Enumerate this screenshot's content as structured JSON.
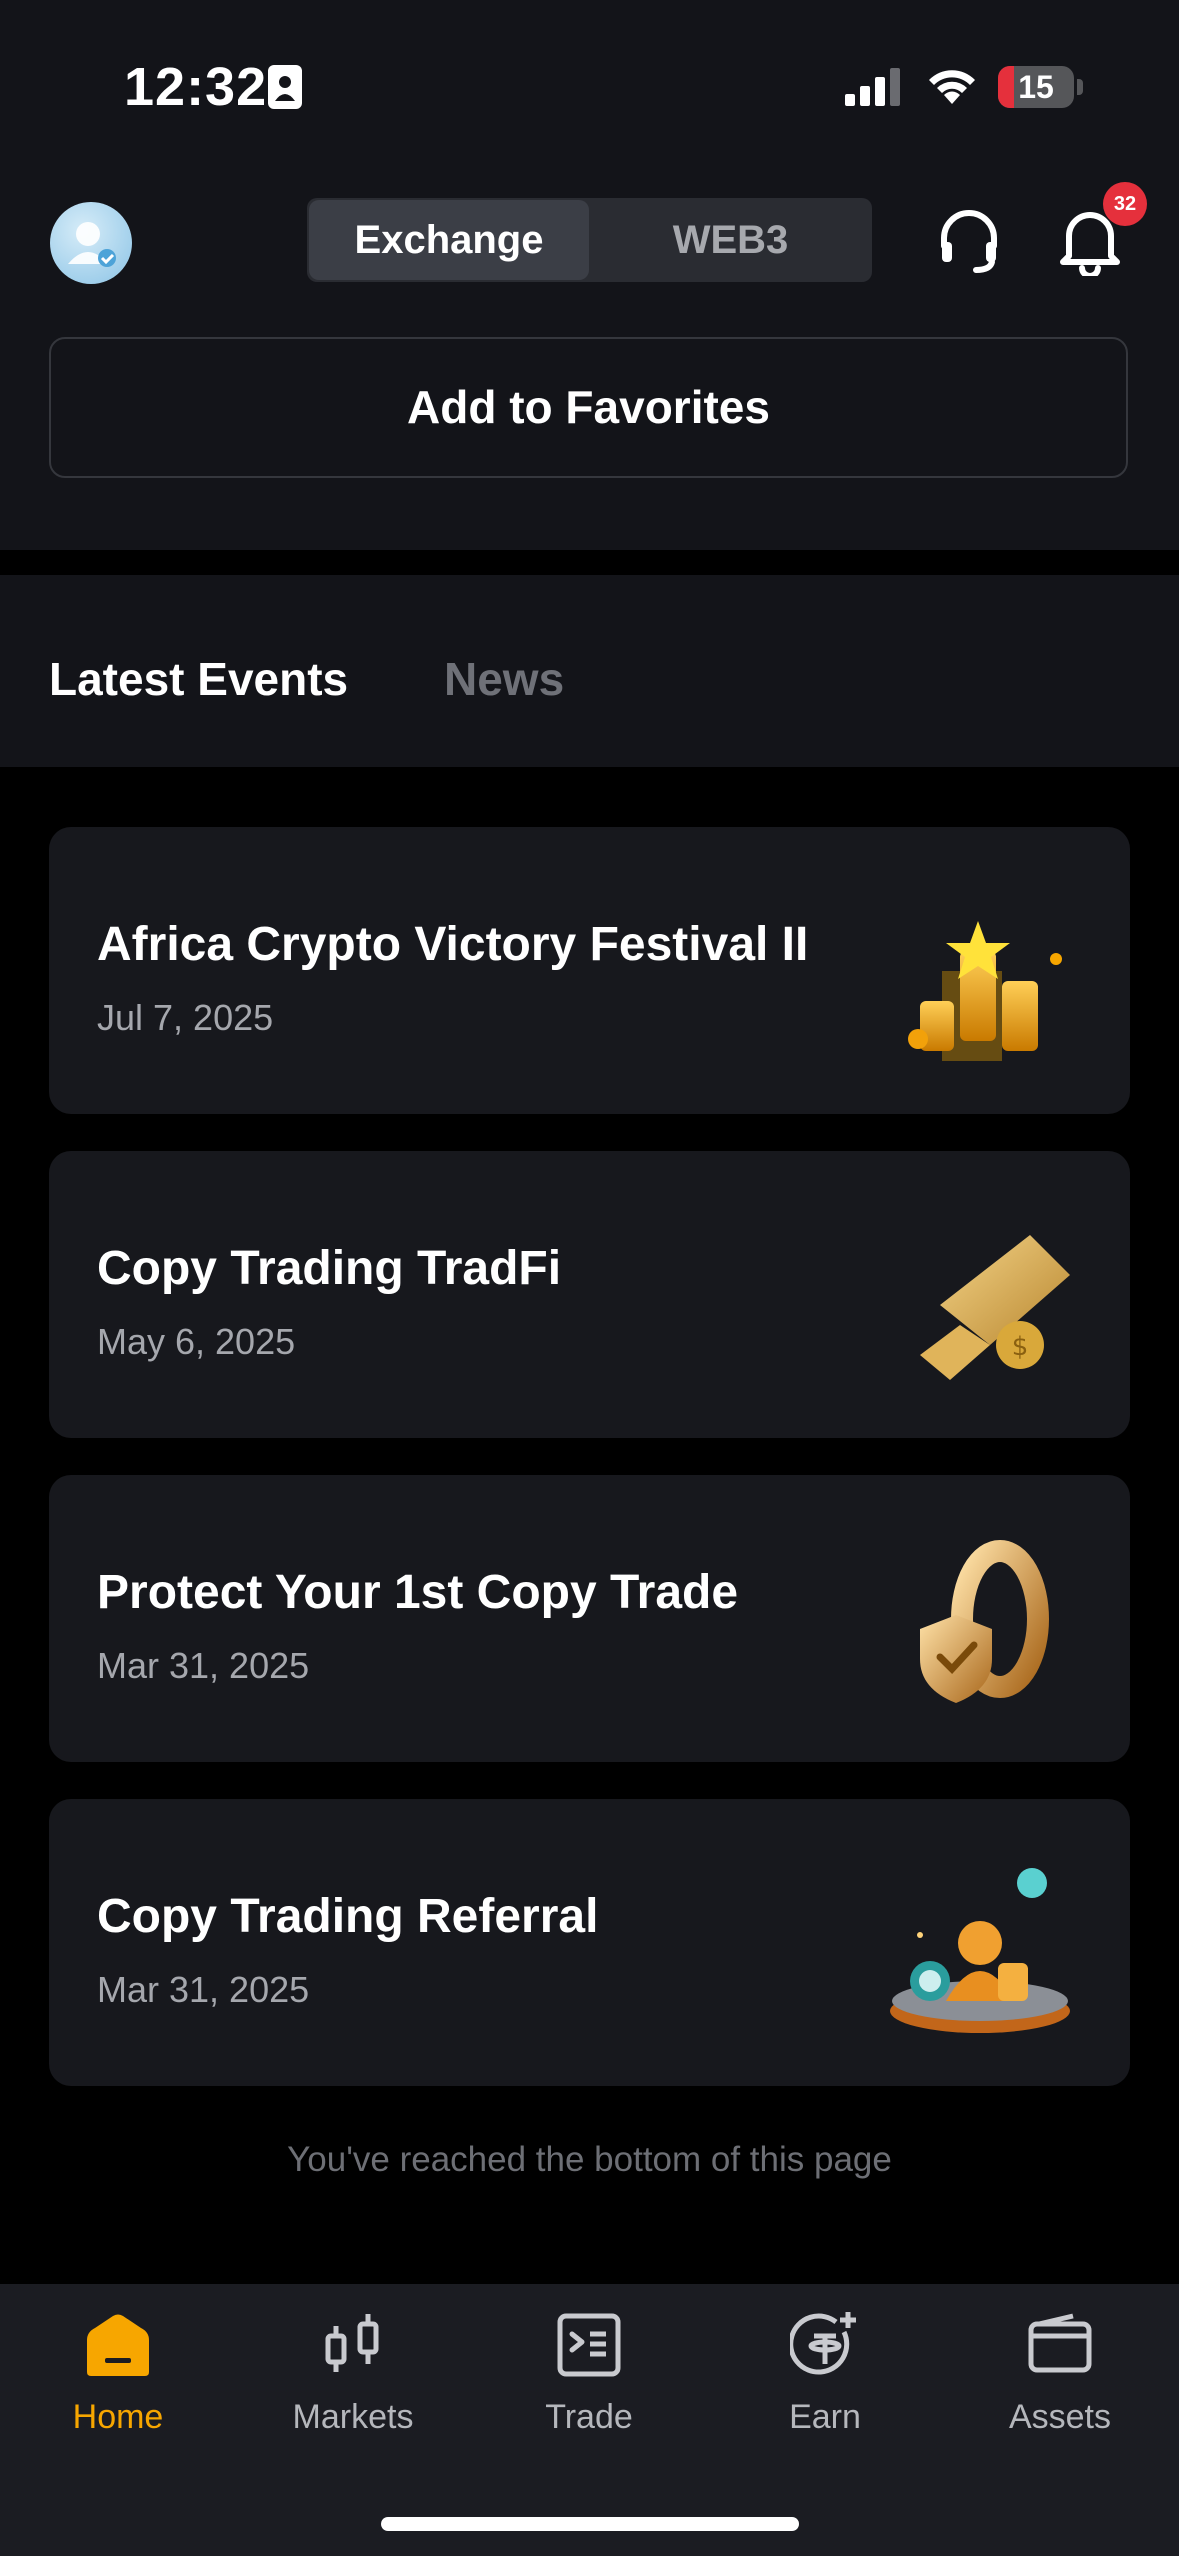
{
  "status_bar": {
    "time": "12:32",
    "battery": "15"
  },
  "header": {
    "segments": [
      "Exchange",
      "WEB3"
    ],
    "active_segment": "Exchange",
    "notification_count": "32",
    "icons": [
      "avatar",
      "headset-icon",
      "bell-icon"
    ]
  },
  "favorites_button": "Add to Favorites",
  "tabs": [
    "Latest Events",
    "News"
  ],
  "active_tab": "Latest Events",
  "events": [
    {
      "title": "Africa Crypto Victory Festival II",
      "date": "Jul 7, 2025",
      "art": "trophy-bars-star"
    },
    {
      "title": "Copy Trading TradFi",
      "date": "May 6, 2025",
      "art": "gold-ticket-coin"
    },
    {
      "title": "Protect Your 1st Copy Trade",
      "date": "Mar 31, 2025",
      "art": "shield-zero"
    },
    {
      "title": "Copy Trading Referral",
      "date": "Mar 31, 2025",
      "art": "person-coins-platform"
    }
  ],
  "footer_note": "You've reached the bottom of this page",
  "nav": [
    {
      "label": "Home",
      "icon": "home-icon",
      "active": true
    },
    {
      "label": "Markets",
      "icon": "candlestick-icon",
      "active": false
    },
    {
      "label": "Trade",
      "icon": "trade-icon",
      "active": false
    },
    {
      "label": "Earn",
      "icon": "earn-icon",
      "active": false
    },
    {
      "label": "Assets",
      "icon": "wallet-icon",
      "active": false
    }
  ],
  "colors": {
    "accent": "#f7a600",
    "badge": "#e5303c",
    "background": "#000000",
    "card": "#17181d"
  }
}
